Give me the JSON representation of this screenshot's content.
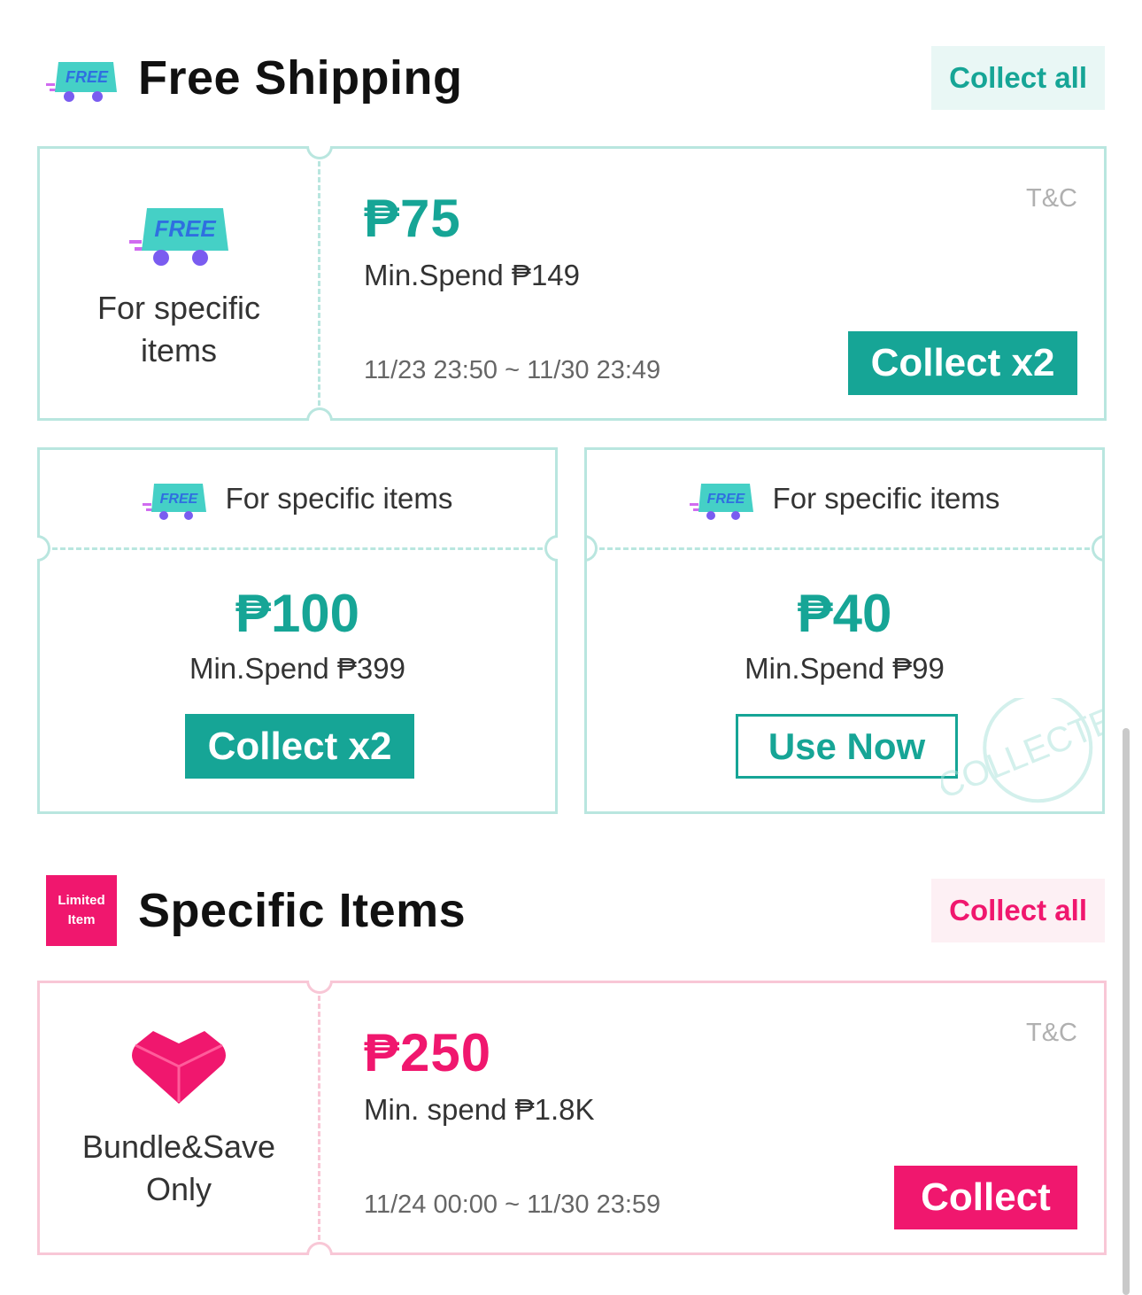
{
  "free_shipping": {
    "title": "Free Shipping",
    "collect_all": "Collect all",
    "badge_text": "FREE",
    "colors": {
      "accent": "#16a596",
      "border": "#b9e6df"
    },
    "voucher_main": {
      "left_label": "For specific items",
      "amount": "₱75",
      "min_spend": "Min.Spend ₱149",
      "validity": "11/23 23:50 ~ 11/30 23:49",
      "tc": "T&C",
      "button": "Collect x2"
    },
    "voucher_left": {
      "label": "For specific items",
      "amount": "₱100",
      "min_spend": "Min.Spend ₱399",
      "button": "Collect x2"
    },
    "voucher_right": {
      "label": "For specific items",
      "amount": "₱40",
      "min_spend": "Min.Spend ₱99",
      "button": "Use Now",
      "stamp": "COLLECTED"
    }
  },
  "specific_items": {
    "title": "Specific Items",
    "collect_all": "Collect all",
    "badge_line1": "Limited",
    "badge_line2": "Item",
    "colors": {
      "accent": "#f0176e",
      "border": "#f8c7d6"
    },
    "voucher": {
      "left_label": "Bundle&Save Only",
      "amount": "₱250",
      "min_spend": "Min. spend ₱1.8K",
      "validity": "11/24 00:00 ~ 11/30 23:59",
      "tc": "T&C",
      "button": "Collect"
    }
  }
}
